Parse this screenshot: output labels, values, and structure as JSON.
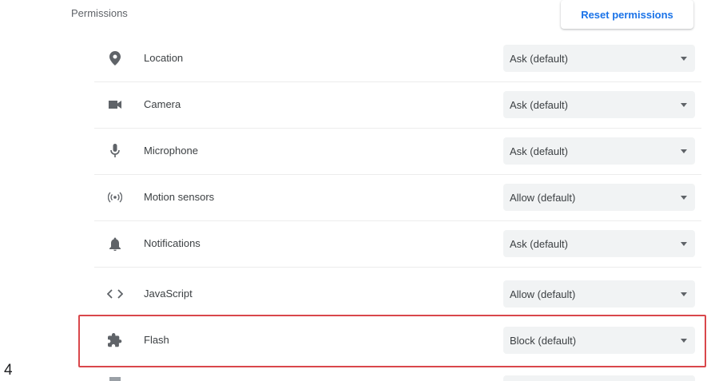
{
  "section": {
    "title": "Permissions"
  },
  "reset_button": {
    "label": "Reset permissions"
  },
  "permissions": [
    {
      "label": "Location",
      "icon": "location-icon",
      "value": "Ask (default)"
    },
    {
      "label": "Camera",
      "icon": "camera-icon",
      "value": "Ask (default)"
    },
    {
      "label": "Microphone",
      "icon": "microphone-icon",
      "value": "Ask (default)"
    },
    {
      "label": "Motion sensors",
      "icon": "motion-sensors-icon",
      "value": "Allow (default)"
    },
    {
      "label": "Notifications",
      "icon": "notifications-icon",
      "value": "Ask (default)"
    },
    {
      "label": "JavaScript",
      "icon": "javascript-icon",
      "value": "Allow (default)"
    },
    {
      "label": "Flash",
      "icon": "flash-puzzle-icon",
      "value": "Block (default)"
    }
  ],
  "annotation": {
    "step": "4",
    "highlight_color": "#d9474b"
  },
  "colors": {
    "accent": "#1a73e8",
    "text": "#3c4043",
    "select_bg": "#f1f3f4"
  }
}
